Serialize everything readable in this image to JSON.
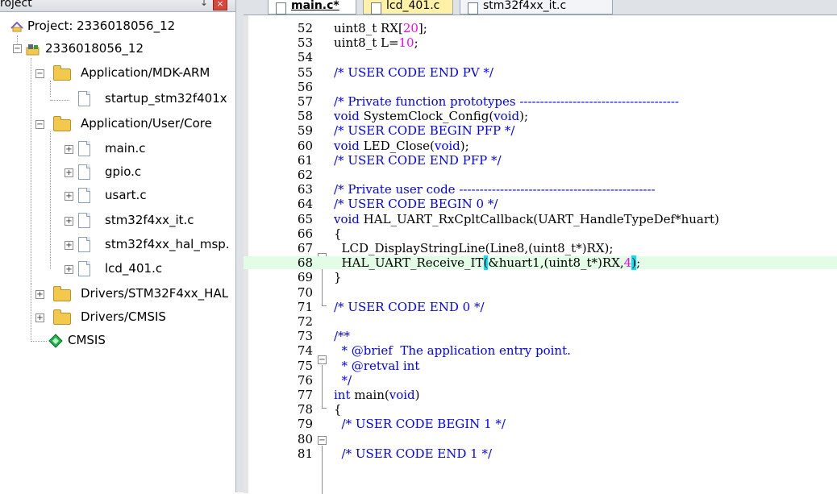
{
  "project_panel": {
    "header": {
      "title": "roject",
      "pin": "↓",
      "close": "×"
    },
    "tree": [
      {
        "label": "Project: 2336018056_12",
        "level": 0,
        "icon": "project-icon"
      },
      {
        "label": "2336018056_12",
        "level": 1,
        "icon": "target-icon",
        "expander": "−"
      },
      {
        "label": "Application/MDK-ARM",
        "level": 2,
        "icon": "folder-icon",
        "expander": "−"
      },
      {
        "label": "startup_stm32f401x",
        "level": 3,
        "icon": "file-icon"
      },
      {
        "label": "Application/User/Core",
        "level": 2,
        "icon": "folder-icon",
        "expander": "−"
      },
      {
        "label": "main.c",
        "level": 3,
        "icon": "file-icon",
        "expander": "+"
      },
      {
        "label": "gpio.c",
        "level": 3,
        "icon": "file-icon",
        "expander": "+"
      },
      {
        "label": "usart.c",
        "level": 3,
        "icon": "file-icon",
        "expander": "+"
      },
      {
        "label": "stm32f4xx_it.c",
        "level": 3,
        "icon": "file-icon",
        "expander": "+"
      },
      {
        "label": "stm32f4xx_hal_msp.",
        "level": 3,
        "icon": "file-icon",
        "expander": "+"
      },
      {
        "label": "lcd_401.c",
        "level": 3,
        "icon": "file-icon",
        "expander": "+"
      },
      {
        "label": "Drivers/STM32F4xx_HAL",
        "level": 2,
        "icon": "folder-icon",
        "expander": "+"
      },
      {
        "label": "Drivers/CMSIS",
        "level": 2,
        "icon": "folder-icon",
        "expander": "+"
      },
      {
        "label": "CMSIS",
        "level": 2,
        "icon": "cmsis-gem-icon"
      }
    ]
  },
  "tabs": [
    {
      "label": "main.c*",
      "state": "active"
    },
    {
      "label": "lcd_401.c",
      "state": "yellow"
    },
    {
      "label": "stm32f4xx_it.c",
      "state": "plain"
    }
  ],
  "editor": {
    "lines": [
      {
        "n": "52",
        "text": "uint8_t RX[20];"
      },
      {
        "n": "53",
        "text": "uint8_t L=10;"
      },
      {
        "n": "54",
        "text": ""
      },
      {
        "n": "55",
        "text": "/* USER CODE END PV */"
      },
      {
        "n": "56",
        "text": ""
      },
      {
        "n": "57",
        "text": "/* Private function prototypes ---------------------------------------"
      },
      {
        "n": "58",
        "text": "void SystemClock_Config(void);"
      },
      {
        "n": "59",
        "text": "/* USER CODE BEGIN PFP */"
      },
      {
        "n": "60",
        "text": "void LED_Close(void);"
      },
      {
        "n": "61",
        "text": "/* USER CODE END PFP */"
      },
      {
        "n": "62",
        "text": ""
      },
      {
        "n": "63",
        "text": "/* Private user code ------------------------------------------------"
      },
      {
        "n": "64",
        "text": "/* USER CODE BEGIN 0 */"
      },
      {
        "n": "65",
        "text": "void HAL_UART_RxCpltCallback(UART_HandleTypeDef*huart)"
      },
      {
        "n": "66",
        "text": "{"
      },
      {
        "n": "67",
        "text": "  LCD_DisplayStringLine(Line8,(uint8_t*)RX);"
      },
      {
        "n": "68",
        "text": "  HAL_UART_Receive_IT(&huart1,(uint8_t*)RX,4);"
      },
      {
        "n": "69",
        "text": "}"
      },
      {
        "n": "70",
        "text": ""
      },
      {
        "n": "71",
        "text": "/* USER CODE END 0 */"
      },
      {
        "n": "72",
        "text": ""
      },
      {
        "n": "73",
        "text": "/**"
      },
      {
        "n": "74",
        "text": "  * @brief  The application entry point."
      },
      {
        "n": "75",
        "text": "  * @retval int"
      },
      {
        "n": "76",
        "text": "  */"
      },
      {
        "n": "77",
        "text": "int main(void)"
      },
      {
        "n": "78",
        "text": "{"
      },
      {
        "n": "79",
        "text": "  /* USER CODE BEGIN 1 */"
      },
      {
        "n": "80",
        "text": ""
      },
      {
        "n": "81",
        "text": "  /* USER CODE END 1 */"
      }
    ],
    "colors": {
      "keyword": "#0000ff",
      "comment": "#0000ff",
      "number": "#ff00ff",
      "current_line": "#e3fce6",
      "brace_match": "#00e5ff"
    }
  }
}
